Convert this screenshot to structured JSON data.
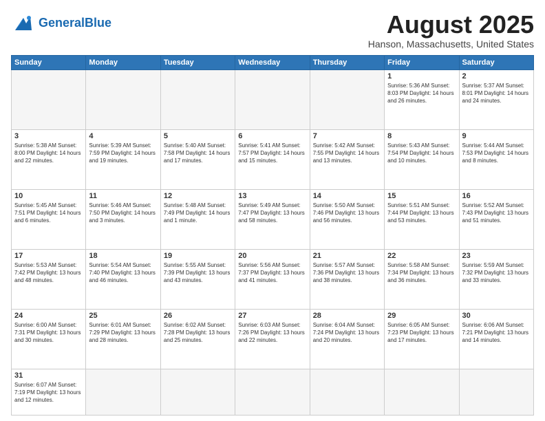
{
  "header": {
    "logo_general": "General",
    "logo_blue": "Blue",
    "month_title": "August 2025",
    "location": "Hanson, Massachusetts, United States"
  },
  "days_of_week": [
    "Sunday",
    "Monday",
    "Tuesday",
    "Wednesday",
    "Thursday",
    "Friday",
    "Saturday"
  ],
  "weeks": [
    [
      {
        "day": "",
        "info": ""
      },
      {
        "day": "",
        "info": ""
      },
      {
        "day": "",
        "info": ""
      },
      {
        "day": "",
        "info": ""
      },
      {
        "day": "",
        "info": ""
      },
      {
        "day": "1",
        "info": "Sunrise: 5:36 AM\nSunset: 8:03 PM\nDaylight: 14 hours and 26 minutes."
      },
      {
        "day": "2",
        "info": "Sunrise: 5:37 AM\nSunset: 8:01 PM\nDaylight: 14 hours and 24 minutes."
      }
    ],
    [
      {
        "day": "3",
        "info": "Sunrise: 5:38 AM\nSunset: 8:00 PM\nDaylight: 14 hours and 22 minutes."
      },
      {
        "day": "4",
        "info": "Sunrise: 5:39 AM\nSunset: 7:59 PM\nDaylight: 14 hours and 19 minutes."
      },
      {
        "day": "5",
        "info": "Sunrise: 5:40 AM\nSunset: 7:58 PM\nDaylight: 14 hours and 17 minutes."
      },
      {
        "day": "6",
        "info": "Sunrise: 5:41 AM\nSunset: 7:57 PM\nDaylight: 14 hours and 15 minutes."
      },
      {
        "day": "7",
        "info": "Sunrise: 5:42 AM\nSunset: 7:55 PM\nDaylight: 14 hours and 13 minutes."
      },
      {
        "day": "8",
        "info": "Sunrise: 5:43 AM\nSunset: 7:54 PM\nDaylight: 14 hours and 10 minutes."
      },
      {
        "day": "9",
        "info": "Sunrise: 5:44 AM\nSunset: 7:53 PM\nDaylight: 14 hours and 8 minutes."
      }
    ],
    [
      {
        "day": "10",
        "info": "Sunrise: 5:45 AM\nSunset: 7:51 PM\nDaylight: 14 hours and 6 minutes."
      },
      {
        "day": "11",
        "info": "Sunrise: 5:46 AM\nSunset: 7:50 PM\nDaylight: 14 hours and 3 minutes."
      },
      {
        "day": "12",
        "info": "Sunrise: 5:48 AM\nSunset: 7:49 PM\nDaylight: 14 hours and 1 minute."
      },
      {
        "day": "13",
        "info": "Sunrise: 5:49 AM\nSunset: 7:47 PM\nDaylight: 13 hours and 58 minutes."
      },
      {
        "day": "14",
        "info": "Sunrise: 5:50 AM\nSunset: 7:46 PM\nDaylight: 13 hours and 56 minutes."
      },
      {
        "day": "15",
        "info": "Sunrise: 5:51 AM\nSunset: 7:44 PM\nDaylight: 13 hours and 53 minutes."
      },
      {
        "day": "16",
        "info": "Sunrise: 5:52 AM\nSunset: 7:43 PM\nDaylight: 13 hours and 51 minutes."
      }
    ],
    [
      {
        "day": "17",
        "info": "Sunrise: 5:53 AM\nSunset: 7:42 PM\nDaylight: 13 hours and 48 minutes."
      },
      {
        "day": "18",
        "info": "Sunrise: 5:54 AM\nSunset: 7:40 PM\nDaylight: 13 hours and 46 minutes."
      },
      {
        "day": "19",
        "info": "Sunrise: 5:55 AM\nSunset: 7:39 PM\nDaylight: 13 hours and 43 minutes."
      },
      {
        "day": "20",
        "info": "Sunrise: 5:56 AM\nSunset: 7:37 PM\nDaylight: 13 hours and 41 minutes."
      },
      {
        "day": "21",
        "info": "Sunrise: 5:57 AM\nSunset: 7:36 PM\nDaylight: 13 hours and 38 minutes."
      },
      {
        "day": "22",
        "info": "Sunrise: 5:58 AM\nSunset: 7:34 PM\nDaylight: 13 hours and 36 minutes."
      },
      {
        "day": "23",
        "info": "Sunrise: 5:59 AM\nSunset: 7:32 PM\nDaylight: 13 hours and 33 minutes."
      }
    ],
    [
      {
        "day": "24",
        "info": "Sunrise: 6:00 AM\nSunset: 7:31 PM\nDaylight: 13 hours and 30 minutes."
      },
      {
        "day": "25",
        "info": "Sunrise: 6:01 AM\nSunset: 7:29 PM\nDaylight: 13 hours and 28 minutes."
      },
      {
        "day": "26",
        "info": "Sunrise: 6:02 AM\nSunset: 7:28 PM\nDaylight: 13 hours and 25 minutes."
      },
      {
        "day": "27",
        "info": "Sunrise: 6:03 AM\nSunset: 7:26 PM\nDaylight: 13 hours and 22 minutes."
      },
      {
        "day": "28",
        "info": "Sunrise: 6:04 AM\nSunset: 7:24 PM\nDaylight: 13 hours and 20 minutes."
      },
      {
        "day": "29",
        "info": "Sunrise: 6:05 AM\nSunset: 7:23 PM\nDaylight: 13 hours and 17 minutes."
      },
      {
        "day": "30",
        "info": "Sunrise: 6:06 AM\nSunset: 7:21 PM\nDaylight: 13 hours and 14 minutes."
      }
    ],
    [
      {
        "day": "31",
        "info": "Sunrise: 6:07 AM\nSunset: 7:19 PM\nDaylight: 13 hours and 12 minutes."
      },
      {
        "day": "",
        "info": ""
      },
      {
        "day": "",
        "info": ""
      },
      {
        "day": "",
        "info": ""
      },
      {
        "day": "",
        "info": ""
      },
      {
        "day": "",
        "info": ""
      },
      {
        "day": "",
        "info": ""
      }
    ]
  ]
}
